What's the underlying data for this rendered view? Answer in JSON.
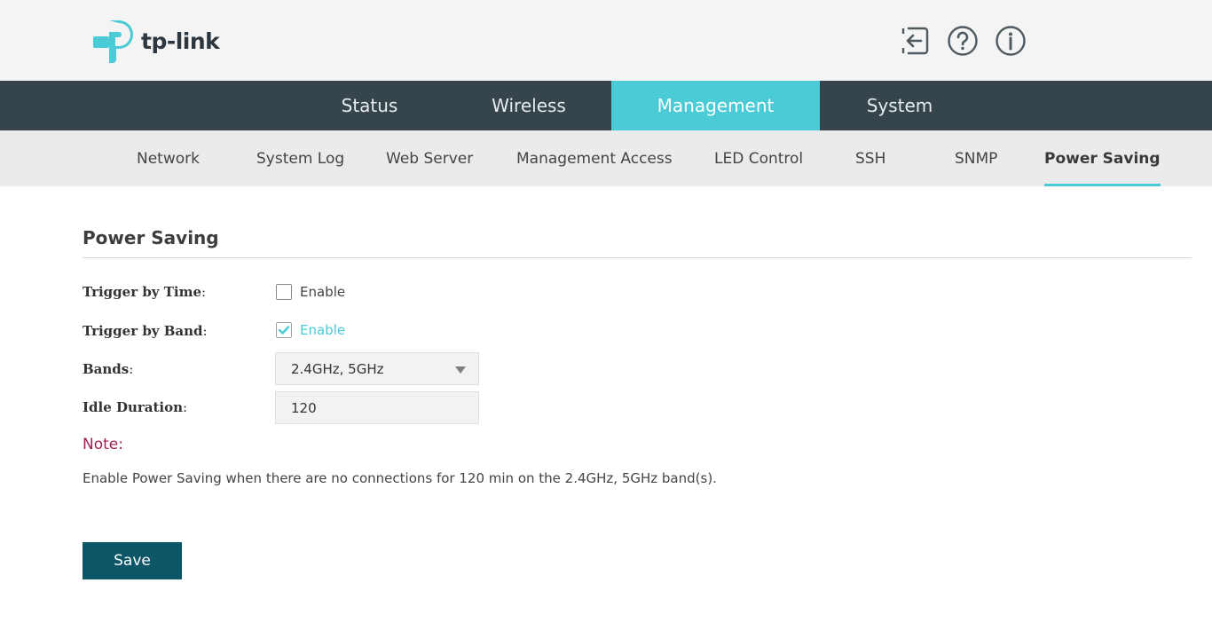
{
  "header": {
    "logo_text": "tp-link",
    "icons": [
      "logout-icon",
      "help-icon",
      "info-icon"
    ]
  },
  "main_nav": {
    "tabs": [
      {
        "label": "Status",
        "active": false
      },
      {
        "label": "Wireless",
        "active": false
      },
      {
        "label": "Management",
        "active": true
      },
      {
        "label": "System",
        "active": false
      }
    ]
  },
  "sub_nav": {
    "items": [
      {
        "label": "Network",
        "active": false
      },
      {
        "label": "System Log",
        "active": false
      },
      {
        "label": "Web Server",
        "active": false
      },
      {
        "label": "Management Access",
        "active": false
      },
      {
        "label": "LED Control",
        "active": false
      },
      {
        "label": "SSH",
        "active": false
      },
      {
        "label": "SNMP",
        "active": false
      },
      {
        "label": "Power Saving",
        "active": true
      }
    ]
  },
  "content": {
    "title": "Power Saving",
    "trigger_by_time": {
      "label": "Trigger by Time",
      "colon": ":",
      "option": "Enable",
      "checked": false
    },
    "trigger_by_band": {
      "label": "Trigger by Band",
      "colon": ":",
      "option": "Enable",
      "checked": true
    },
    "bands": {
      "label": "Bands",
      "colon": ":",
      "value": "2.4GHz, 5GHz"
    },
    "idle_duration": {
      "label": "Idle Duration",
      "colon": ":",
      "value": "120"
    },
    "note": {
      "title": "Note:",
      "text": "Enable Power Saving when there are no connections for 120 min on the 2.4GHz, 5GHz band(s)."
    },
    "save_label": "Save"
  },
  "colors": {
    "nav_bg": "#36444b",
    "accent": "#4acbd6",
    "save_button": "#0d5667",
    "note": "#a31f55"
  }
}
